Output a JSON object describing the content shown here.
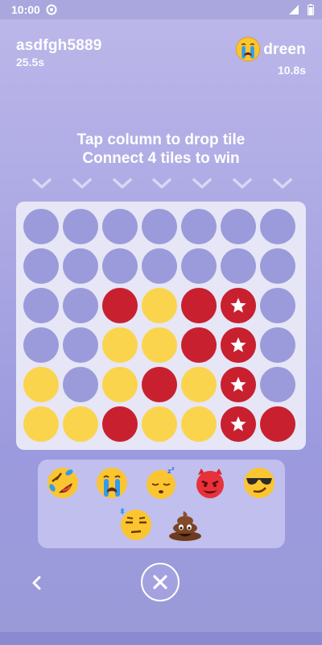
{
  "status_bar": {
    "time": "10:00"
  },
  "players": {
    "left": {
      "name": "asdfgh5889",
      "time": "25.5s"
    },
    "right": {
      "name": "dreen",
      "time": "10.8s",
      "avatar_icon": "crying-face-emoji"
    }
  },
  "instructions": {
    "line1": "Tap column to drop tile",
    "line2": "Connect 4 tiles to win"
  },
  "board": {
    "columns": 7,
    "rows": 6,
    "grid": [
      [
        "empty",
        "empty",
        "empty",
        "empty",
        "empty",
        "empty",
        "empty"
      ],
      [
        "empty",
        "empty",
        "empty",
        "empty",
        "empty",
        "empty",
        "empty"
      ],
      [
        "empty",
        "empty",
        "red",
        "yellow",
        "red",
        "red-star",
        "empty"
      ],
      [
        "empty",
        "empty",
        "yellow",
        "yellow",
        "red",
        "red-star",
        "empty"
      ],
      [
        "yellow",
        "empty",
        "yellow",
        "red",
        "yellow",
        "red-star",
        "empty"
      ],
      [
        "yellow",
        "yellow",
        "red",
        "yellow",
        "yellow",
        "red-star",
        "red"
      ]
    ],
    "colors": {
      "red": "#c8202f",
      "yellow": "#fbd44d",
      "empty": "#9b9bdb",
      "board": "#e6e6f6"
    }
  },
  "emojis": [
    "rolling-laughing-emoji",
    "loudly-crying-emoji",
    "sleeping-emoji",
    "smiling-devil-emoji",
    "cool-sunglasses-emoji",
    "annoyed-face-emoji",
    "poop-emoji"
  ]
}
